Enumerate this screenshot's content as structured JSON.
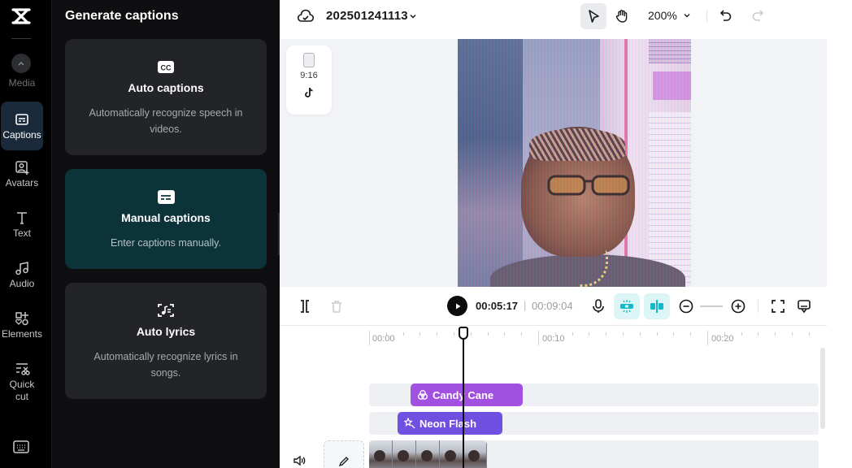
{
  "rail": {
    "media_label": "Media",
    "items": [
      {
        "id": "captions",
        "label": "Captions",
        "icon": "captions-icon",
        "active": true
      },
      {
        "id": "avatars",
        "label": "Avatars",
        "icon": "avatar-icon"
      },
      {
        "id": "text",
        "label": "Text",
        "icon": "text-icon"
      },
      {
        "id": "audio",
        "label": "Audio",
        "icon": "music-note-icon"
      },
      {
        "id": "elements",
        "label": "Elements",
        "icon": "shapes-icon"
      },
      {
        "id": "quick-cut",
        "label": "Quick\ncut",
        "label_line1": "Quick",
        "label_line2": "cut",
        "icon": "scissors-icon"
      }
    ]
  },
  "panel": {
    "title": "Generate captions",
    "cards": [
      {
        "title": "Auto captions",
        "desc": "Automatically recognize speech in videos.",
        "icon": "cc-icon"
      },
      {
        "title": "Manual captions",
        "desc": "Enter captions manually.",
        "icon": "subtitle-icon",
        "selected": true
      },
      {
        "title": "Auto lyrics",
        "desc": "Automatically recognize lyrics in songs.",
        "icon": "lyrics-icon"
      }
    ]
  },
  "topbar": {
    "project_name": "202501241113",
    "zoom": "200%"
  },
  "preview": {
    "aspect_ratio": "9:16",
    "platform_icon": "tiktok-icon"
  },
  "player": {
    "current_time": "00:05:17",
    "separator": "|",
    "total_time": "00:09:04"
  },
  "timeline": {
    "ruler_labels": [
      "00:00",
      "00:10",
      "00:20"
    ],
    "clips": [
      {
        "name": "Candy Cane",
        "icon": "filter-icon",
        "color": "#a150e0"
      },
      {
        "name": "Neon Flash",
        "icon": "effect-sparkle-icon",
        "color": "#7050e0"
      }
    ]
  },
  "colors": {
    "accent_cyan": "#dcf6f8",
    "selected_card": "#0c333a",
    "playhead": "#0b0c0e"
  }
}
